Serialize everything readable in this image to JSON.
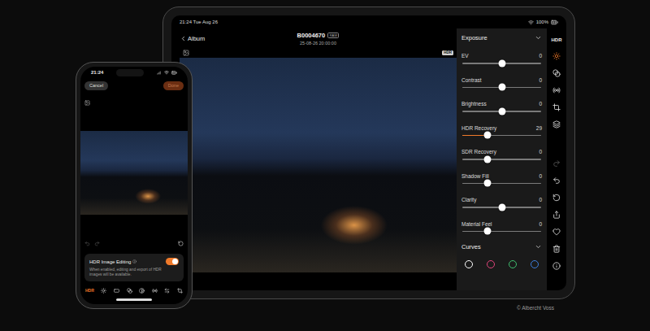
{
  "tablet": {
    "status_bar": {
      "time": "21:24 Tue Aug 26",
      "battery": "100%"
    },
    "header": {
      "back": "Album",
      "title": "B0004670",
      "badge": "RAW",
      "subtitle": "25-08-26 20:00:00"
    },
    "photo_badge": "HDR",
    "panel": {
      "section": "Exposure",
      "expanded": true,
      "sliders": [
        {
          "label": "EV",
          "value": "0",
          "level": 0.5,
          "highlighted": false
        },
        {
          "label": "Contrast",
          "value": "0",
          "level": 0.5,
          "highlighted": false
        },
        {
          "label": "Brightness",
          "value": "0",
          "level": 0.5,
          "highlighted": false
        },
        {
          "label": "HDR Recovery",
          "value": "29",
          "level": 0.32,
          "highlighted": true
        },
        {
          "label": "SDR Recovery",
          "value": "0",
          "level": 0.32,
          "highlighted": false
        },
        {
          "label": "Shadow Fill",
          "value": "0",
          "level": 0.32,
          "highlighted": false
        },
        {
          "label": "Clarity",
          "value": "0",
          "level": 0.5,
          "highlighted": false
        },
        {
          "label": "Material Feel",
          "value": "0",
          "level": 0.32,
          "highlighted": false
        }
      ],
      "curves": {
        "label": "Curves",
        "expanded": true,
        "channels": [
          {
            "color": "#ffffff"
          },
          {
            "color": "#e0457b"
          },
          {
            "color": "#3fbf6f"
          },
          {
            "color": "#3d7fe0"
          }
        ]
      }
    },
    "toolbar": {
      "label": "HDR",
      "label_selected": false,
      "tools": [
        {
          "selected": true
        },
        {
          "selected": false
        },
        {
          "selected": false
        },
        {
          "selected": false
        },
        {
          "selected": false
        }
      ],
      "actions": [
        {
          "disabled": true
        },
        {
          "disabled": false
        },
        {
          "disabled": false
        },
        {
          "disabled": false
        },
        {
          "disabled": false
        },
        {
          "disabled": false
        },
        {
          "disabled": false
        }
      ]
    }
  },
  "phone": {
    "status_bar": {
      "time": "21:24"
    },
    "buttons": [
      {
        "label": "Cancel",
        "kind": "secondary",
        "disabled": false
      },
      {
        "label": "Done",
        "kind": "primary",
        "disabled": true
      }
    ],
    "history": [
      {
        "disabled": true
      },
      {
        "disabled": true
      }
    ],
    "hdr_editing": {
      "title": "HDR Image Editing",
      "description": "When enabled, editing and export of HDR images will be available.",
      "on": true
    },
    "toolbar": {
      "label": "HDR",
      "label_selected": true,
      "tools": [
        {
          "selected": false
        },
        {
          "selected": false
        },
        {
          "selected": false
        },
        {
          "selected": false
        },
        {
          "selected": false
        },
        {
          "selected": false
        },
        {
          "selected": false
        }
      ]
    }
  },
  "credit": "© Albercht Voss"
}
